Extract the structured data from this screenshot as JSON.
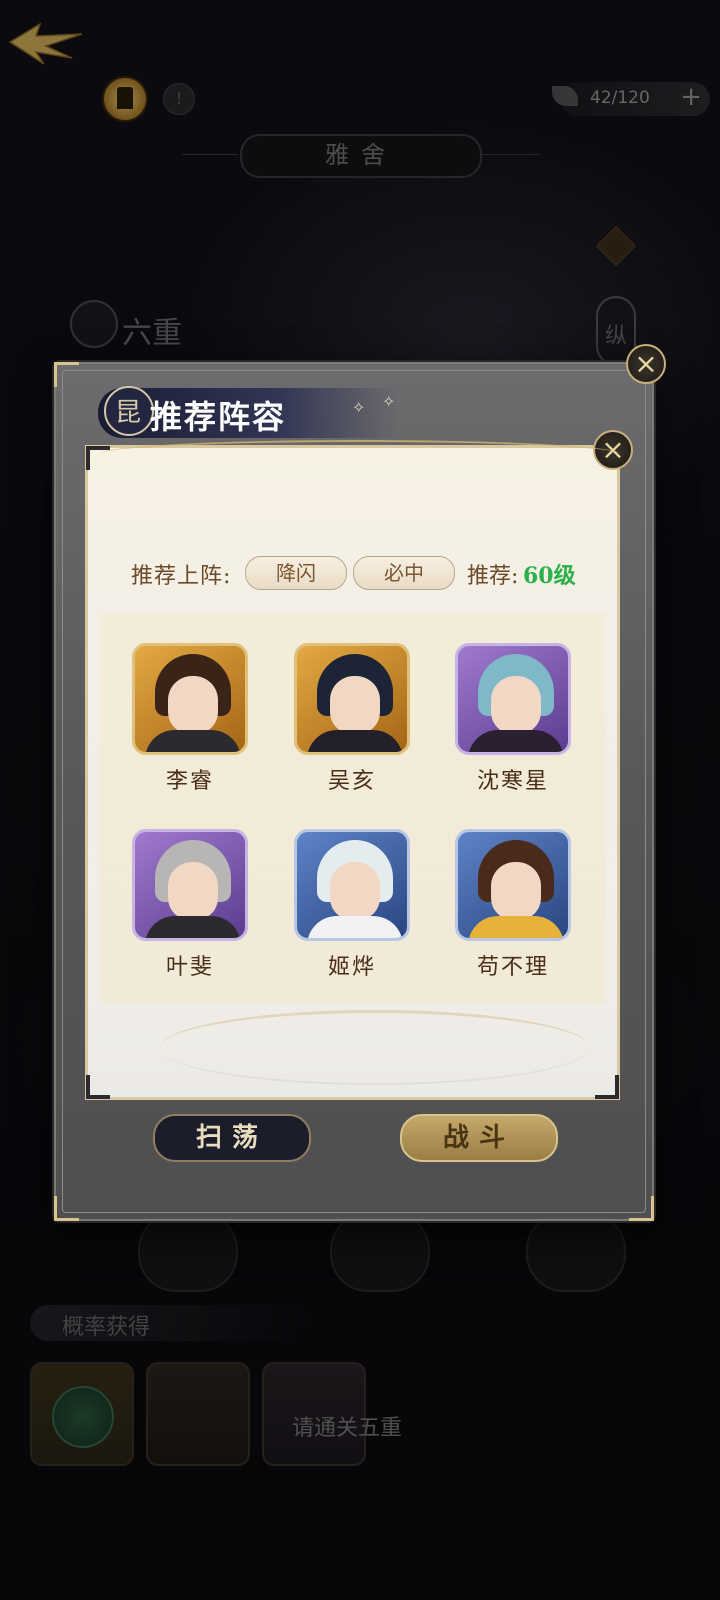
{
  "topbar": {
    "stamina": "42/120",
    "stamina_plus": "+",
    "info_label": "!"
  },
  "location": {
    "name": "雅舍"
  },
  "stage": {
    "title": "六重",
    "side_tag": "纵"
  },
  "modal": {
    "title": "推荐阵容",
    "header_glyph": "昆",
    "recommend_label": "推荐上阵:",
    "tags": [
      "降闪",
      "必中"
    ],
    "level_label": "推荐:",
    "level_value": "60级",
    "heroes": [
      {
        "name": "李睿",
        "frame": "gold"
      },
      {
        "name": "吴亥",
        "frame": "gold"
      },
      {
        "name": "沈寒星",
        "frame": "purple"
      },
      {
        "name": "叶斐",
        "frame": "purple"
      },
      {
        "name": "姬烨",
        "frame": "blue"
      },
      {
        "name": "苟不理",
        "frame": "blue"
      }
    ],
    "sweep_label": "扫荡",
    "fight_label": "战斗",
    "close_icon": "×"
  },
  "rewards": {
    "label": "概率获得",
    "locked_text": "请通关五重"
  },
  "colors": {
    "accent_gold": "#d8c48e",
    "level_green": "#2bb04a",
    "title_text": "#ffffff"
  }
}
